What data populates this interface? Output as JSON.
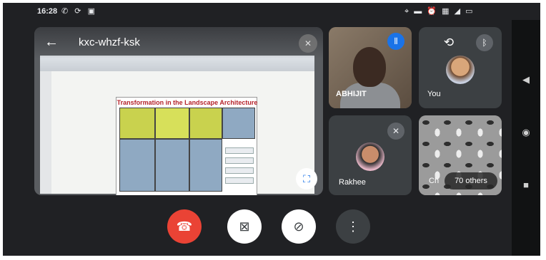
{
  "status_bar": {
    "time": "16:28",
    "left_icons": [
      "whatsapp-icon",
      "sync-icon",
      "image-icon"
    ],
    "right_icons": [
      "location-icon",
      "battery-saver-icon",
      "alarm-icon",
      "sim-icon",
      "signal-icon",
      "battery-icon"
    ]
  },
  "meeting": {
    "room_code": "kxc-whzf-ksk",
    "presentation": {
      "doc_title": "Transformation in the Landscape Architecture"
    }
  },
  "participants": [
    {
      "name": "ABHIJIT",
      "muted": false
    },
    {
      "name": "You",
      "muted": false
    },
    {
      "name": "Rakhee",
      "muted": true
    }
  ],
  "others": {
    "partial_name": "Ch",
    "count_label": "70 others"
  },
  "controls": {
    "end_call": "end-call-icon",
    "camera": "camera-off-icon",
    "mic": "mic-off-icon",
    "more": "more-vert-icon"
  },
  "colors": {
    "background": "#202124",
    "end_call": "#ea4335",
    "accent": "#1a73e8",
    "tile": "#3c4043"
  }
}
